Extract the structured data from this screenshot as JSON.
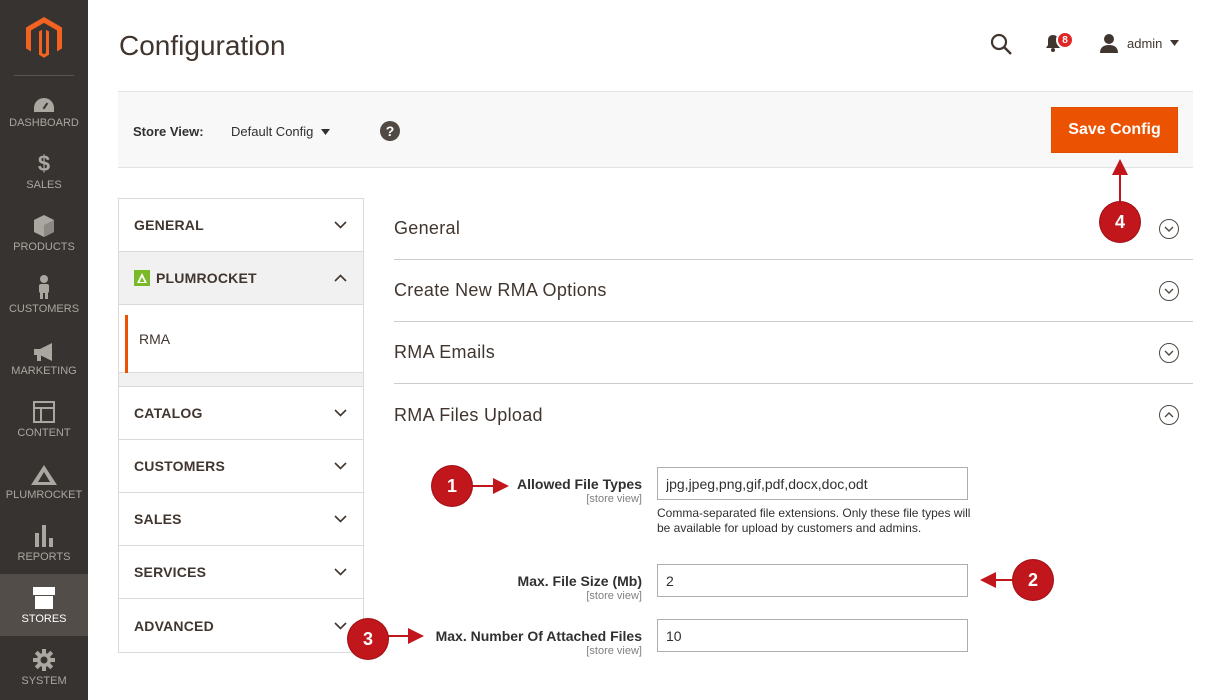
{
  "sidebar": {
    "items": [
      {
        "label": "DASHBOARD",
        "icon": "dashboard-icon"
      },
      {
        "label": "SALES",
        "icon": "dollar-icon"
      },
      {
        "label": "PRODUCTS",
        "icon": "box-icon"
      },
      {
        "label": "CUSTOMERS",
        "icon": "person-icon"
      },
      {
        "label": "MARKETING",
        "icon": "megaphone-icon"
      },
      {
        "label": "CONTENT",
        "icon": "layout-icon"
      },
      {
        "label": "PLUMROCKET",
        "icon": "plumrocket-icon"
      },
      {
        "label": "REPORTS",
        "icon": "bar-chart-icon"
      },
      {
        "label": "STORES",
        "icon": "store-icon",
        "active": true
      },
      {
        "label": "SYSTEM",
        "icon": "gear-icon"
      }
    ]
  },
  "header": {
    "title": "Configuration",
    "notifications_count": "8",
    "user": "admin"
  },
  "store_bar": {
    "label": "Store View:",
    "value": "Default Config",
    "save_label": "Save Config"
  },
  "tabs": {
    "general": "GENERAL",
    "plumrocket": "PLUMROCKET",
    "rma": "RMA",
    "catalog": "CATALOG",
    "customers": "CUSTOMERS",
    "sales": "SALES",
    "services": "SERVICES",
    "advanced": "ADVANCED"
  },
  "sections": {
    "general": "General",
    "create_new": "Create New RMA Options",
    "emails": "RMA Emails",
    "files_upload": "RMA Files Upload"
  },
  "fields": {
    "allowed_types": {
      "label": "Allowed File Types",
      "scope": "[store view]",
      "value": "jpg,jpeg,png,gif,pdf,docx,doc,odt",
      "note": "Comma-separated file extensions. Only these file types will be available for upload by customers and admins."
    },
    "max_size": {
      "label": "Max. File Size (Mb)",
      "scope": "[store view]",
      "value": "2"
    },
    "max_files": {
      "label": "Max. Number Of Attached Files",
      "scope": "[store view]",
      "value": "10"
    }
  },
  "callouts": [
    "1",
    "2",
    "3",
    "4"
  ],
  "colors": {
    "accent": "#eb5202",
    "sidebar": "#373330",
    "callout": "#c0161c"
  }
}
